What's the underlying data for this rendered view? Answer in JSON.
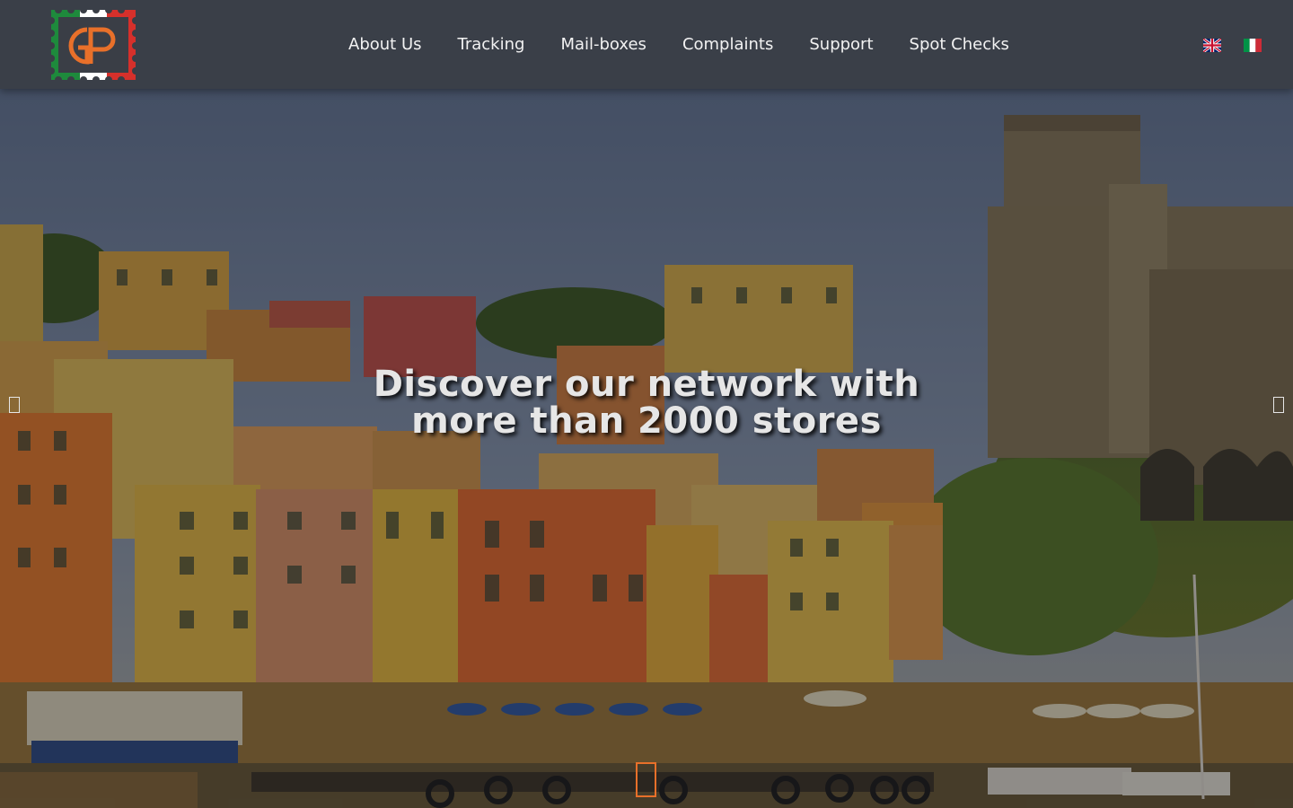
{
  "brand": {
    "logo_text": "GP",
    "colors": {
      "green": "#1e8a3c",
      "red": "#d6302b",
      "white": "#ffffff",
      "orange": "#e8702a"
    }
  },
  "nav": {
    "items": [
      {
        "label": "About Us"
      },
      {
        "label": "Tracking"
      },
      {
        "label": "Mail-boxes"
      },
      {
        "label": "Complaints"
      },
      {
        "label": "Support"
      },
      {
        "label": "Spot Checks"
      }
    ]
  },
  "languages": [
    {
      "code": "en",
      "icon": "uk-flag-icon"
    },
    {
      "code": "it",
      "icon": "italy-flag-icon"
    }
  ],
  "hero": {
    "headline_line1": "Discover our network with",
    "headline_line2": "more than 2000 stores",
    "prev_icon": "chevron-left-icon",
    "next_icon": "chevron-right-icon",
    "active_slide": 1,
    "slide_count": 1
  },
  "colors": {
    "header_bg": "#3a3e46",
    "nav_text": "#f2f2f2",
    "indicator": "#e8702a"
  }
}
